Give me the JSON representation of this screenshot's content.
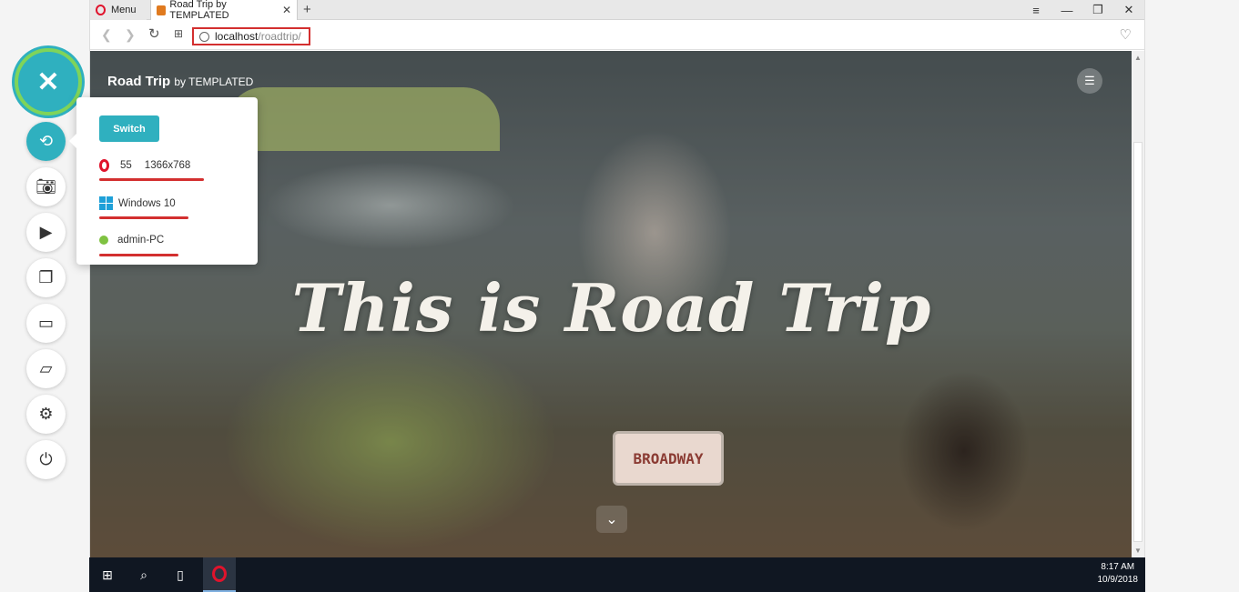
{
  "browser": {
    "menu_label": "Menu",
    "tab_title": "Road Trip by TEMPLATED",
    "new_tab": "+",
    "url_host": "localhost",
    "url_path": "/roadtrip/"
  },
  "page": {
    "brand": "Road Trip",
    "brand_by": "by TEMPLATED",
    "hero": "This is Road Trip",
    "plate": "BROADWAY"
  },
  "popup": {
    "switch_label": "Switch",
    "browser_version": "55",
    "resolution": "1366x768",
    "os": "Windows 10",
    "machine": "admin-PC"
  },
  "taskbar": {
    "time": "8:17 AM",
    "date": "10/9/2018"
  },
  "colors": {
    "accent": "#2fb0bf",
    "highlight_red": "#d32f2f",
    "online_green": "#7fc241"
  },
  "icons": [
    "close-icon",
    "switch-icon",
    "camera-icon",
    "video-icon",
    "files-icon",
    "screen-icon",
    "folder-icon",
    "gear-icon",
    "power-icon"
  ]
}
